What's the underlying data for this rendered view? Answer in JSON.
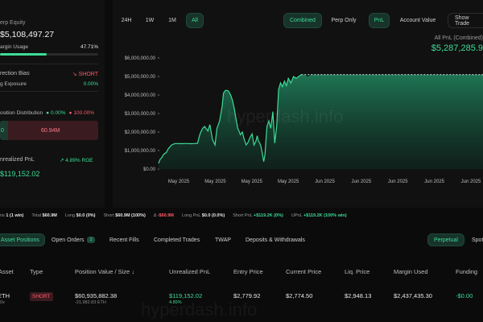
{
  "left_panel": {
    "equity_label": "erp Equity",
    "equity_value": "$5,108,497.27",
    "margin_label": "argin Usage",
    "margin_value": "47.71%",
    "margin_fraction": 0.4771,
    "bias_label": "rection Bias",
    "bias_value": "SHORT",
    "exposure_label": "g Exposure",
    "exposure_value": "0.00%",
    "distribution_label": "osition Distribution",
    "dist_long_pct": "0.00%",
    "dist_short_pct": "100.00%",
    "dist_long_value": "0",
    "dist_short_value": "60.94M",
    "upnl_label": "nrealized PnL",
    "upnl_roe": "4.89% ROE",
    "upnl_value": "$119,152.02"
  },
  "chart_controls": {
    "ranges": [
      "24H",
      "1W",
      "1M",
      "All"
    ],
    "active_range": "All",
    "modes": [
      "Combined",
      "Perp Only"
    ],
    "active_mode": "Combined",
    "metrics": [
      "PnL",
      "Account Value"
    ],
    "active_metric": "PnL",
    "show_trades_label": "Show Trade"
  },
  "pnl_summary": {
    "caption": "All PnL (Combined)",
    "value": "$5,287,285.9"
  },
  "watermark": "hyperdash.info",
  "chart_data": {
    "type": "area",
    "title": "",
    "xlabel": "",
    "ylabel": "",
    "ylim": [
      0,
      6000000
    ],
    "yticks": [
      "$0.00",
      "$1,000,000.00",
      "$2,000,000.00",
      "$3,000,000.00",
      "$4,000,000.00",
      "$5,000,000.00",
      "$6,000,000.00"
    ],
    "xticks": [
      "May 2025",
      "May 2025",
      "May 2025",
      "May 2025",
      "Jun 2025",
      "Jun 2025",
      "Jun 2025",
      "Jun 2025",
      "Jun 2025"
    ],
    "line_color": "#3ddc97",
    "series": [
      {
        "x": [
          0,
          2,
          5,
          8,
          12,
          15,
          20,
          25,
          30,
          35,
          40,
          45,
          50,
          55,
          60,
          63,
          65,
          68,
          71,
          73,
          76,
          79,
          83,
          87,
          90,
          92,
          94,
          96,
          98,
          100,
          103,
          106,
          108,
          111,
          114,
          117,
          120,
          122,
          124,
          126,
          129,
          132,
          135,
          138,
          141,
          144,
          147,
          150,
          152,
          154,
          156,
          158,
          160,
          162,
          164,
          167,
          170,
          173,
          176,
          179,
          182,
          185,
          188,
          191,
          194,
          197,
          200,
          204,
          208,
          212,
          216,
          220,
          225,
          230,
          235,
          240,
          245,
          250,
          255,
          260,
          265,
          270,
          275,
          280,
          285,
          290,
          295,
          300,
          305,
          310,
          315,
          320,
          325,
          330,
          335,
          340,
          345,
          350,
          355,
          360,
          365,
          370,
          375,
          380,
          385,
          390,
          395,
          400,
          405,
          410,
          415,
          420,
          425,
          430,
          435,
          440,
          445,
          450,
          455,
          460,
          470,
          480,
          490,
          500
        ],
        "values": [
          300000,
          500000,
          620000,
          800000,
          900000,
          1100000,
          1300000,
          1380000,
          1380000,
          1370000,
          1380000,
          1380000,
          1370000,
          1380000,
          1390000,
          1800000,
          2000000,
          2200000,
          2300000,
          2200000,
          2050000,
          2400000,
          1600000,
          1300000,
          2200000,
          2400000,
          2600000,
          3000000,
          3400000,
          4100000,
          4250000,
          4250000,
          4200000,
          4000000,
          3700000,
          3200000,
          2600000,
          2200000,
          2050000,
          1850000,
          2000000,
          1600000,
          1300000,
          1450000,
          1700000,
          1900000,
          1300000,
          1500000,
          1800000,
          1500000,
          1400000,
          1200000,
          800000,
          400000,
          800000,
          2300000,
          2600000,
          2200000,
          3100000,
          1400000,
          2300000,
          4300000,
          4650000,
          4450000,
          4750000,
          4500000,
          4900000,
          4650000,
          5000000,
          4900000,
          5000000,
          5100000,
          5100000,
          5000000,
          5100000,
          5100000,
          5100000,
          5100000,
          5100000,
          5100000,
          5100000,
          5100000,
          5100000,
          5100000,
          5100000,
          5100000,
          5100000,
          5100000,
          5100000,
          5100000,
          5100000,
          5100000,
          5100000,
          5100000,
          5100000,
          5100000,
          5100000,
          5100000,
          5100000,
          5100000,
          5100000,
          5100000,
          5100000,
          5100000,
          5100000,
          5100000,
          5100000,
          5100000,
          5100000,
          5100000,
          5100000,
          5100000,
          5100000,
          5100000,
          5100000,
          5100000,
          5100000,
          5100000,
          5100000,
          5100000,
          5100000,
          5100000,
          5100000,
          5100000
        ]
      }
    ]
  },
  "stats": [
    {
      "label": "ns",
      "value": "1 (1 win)"
    },
    {
      "label": "Total",
      "value": "$60.9M"
    },
    {
      "label": "Long",
      "value": "$0.0 (0%)"
    },
    {
      "label": "Short",
      "value": "$60.9M (100%)"
    },
    {
      "label": "Δ",
      "value": "-$60.9M"
    },
    {
      "label": "Long PnL",
      "value": "$0.0 (0.0%)"
    },
    {
      "label": "Short PnL",
      "value": "+$119.2K (0%)"
    },
    {
      "label": "UPnL",
      "value": "+$119.2K (100% win)"
    }
  ],
  "tabs": [
    {
      "label": "Asset Positions",
      "active": true
    },
    {
      "label": "Open Orders",
      "badge": "2"
    },
    {
      "label": "Recent Fills"
    },
    {
      "label": "Completed Trades"
    },
    {
      "label": "TWAP"
    },
    {
      "label": "Deposits & Withdrawals"
    }
  ],
  "view_toggle": {
    "options": [
      "Perpetual",
      "Spot"
    ],
    "active": "Perpetual"
  },
  "table": {
    "headers": [
      "Asset",
      "Type",
      "Position Value / Size",
      "Unrealized PnL",
      "Entry Price",
      "Current Price",
      "Liq. Price",
      "Margin Used",
      "Funding"
    ],
    "row": {
      "asset": "ETH",
      "leverage": "20x",
      "type": "SHORT",
      "position_value": "$60,935,882.38",
      "position_size": "-21,982.83 ETH",
      "upnl": "$119,152.02",
      "upnl_pct": "4.89%",
      "entry_price": "$2,779.92",
      "current_price": "$2,774.50",
      "liq_price": "$2,948.13",
      "margin_used": "$2,437,435.30",
      "funding": "-$0.00"
    }
  }
}
